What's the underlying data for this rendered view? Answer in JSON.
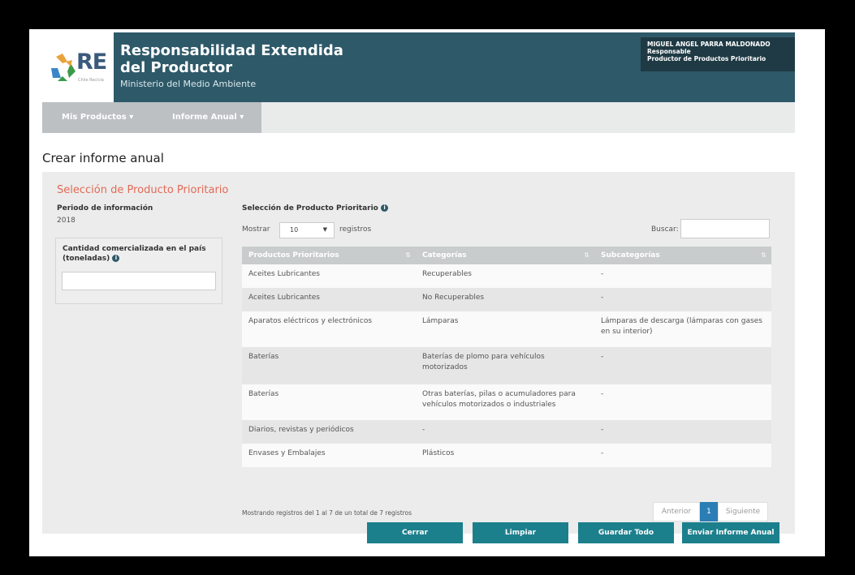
{
  "header": {
    "logo_text": "RE",
    "logo_subtext": "Chile Recicla",
    "title_line1": "Responsabilidad Extendida",
    "title_line2": "del Productor",
    "ministry": "Ministerio del Medio Ambiente",
    "user_name": "MIGUEL ANGEL PARRA MALDONADO",
    "user_role": "Responsable",
    "user_type": "Productor de Productos Prioritario"
  },
  "nav": {
    "items": [
      {
        "label": "Mis Productos ▾"
      },
      {
        "label": "Informe Anual ▾"
      }
    ]
  },
  "page": {
    "title": "Crear informe anual",
    "section_title": "Selección de Producto Prioritario"
  },
  "left": {
    "period_label": "Periodo de información",
    "period_value": "2018",
    "quantity_label": "Cantidad comercializada en el país (toneladas)",
    "quantity_value": ""
  },
  "right": {
    "heading": "Selección de Producto Prioritario",
    "show_label": "Mostrar",
    "show_value": "10",
    "records_label": "registros",
    "search_label": "Buscar:",
    "search_value": ""
  },
  "table": {
    "columns": [
      "Productos Prioritarios",
      "Categorías",
      "Subcategorías"
    ],
    "rows": [
      [
        "Aceites Lubricantes",
        "Recuperables",
        "-"
      ],
      [
        "Aceites Lubricantes",
        "No Recuperables",
        "-"
      ],
      [
        "Aparatos eléctricos y electrónicos",
        "Lámparas",
        "Lámparas de descarga (lámparas con gases en su interior)"
      ],
      [
        "Baterías",
        "Baterías de plomo para vehículos motorizados",
        "-"
      ],
      [
        "Baterías",
        "Otras baterías, pilas o acumuladores para vehículos motorizados o industriales",
        "-"
      ],
      [
        "Diarios, revistas y periódicos",
        "-",
        "-"
      ],
      [
        "Envases y Embalajes",
        "Plásticos",
        "-"
      ]
    ],
    "info": "Mostrando registros del 1 al 7 de un total de 7 registros"
  },
  "pagination": {
    "prev": "Anterior",
    "current": "1",
    "next": "Siguiente"
  },
  "buttons": {
    "close": "Cerrar",
    "clear": "Limpiar",
    "save_all": "Guardar Todo",
    "send": "Enviar Informe Anual"
  },
  "colors": {
    "header": "#2e5969",
    "accent_title": "#e26a55",
    "button": "#1c7f8c",
    "pager_active": "#2a7db5"
  }
}
